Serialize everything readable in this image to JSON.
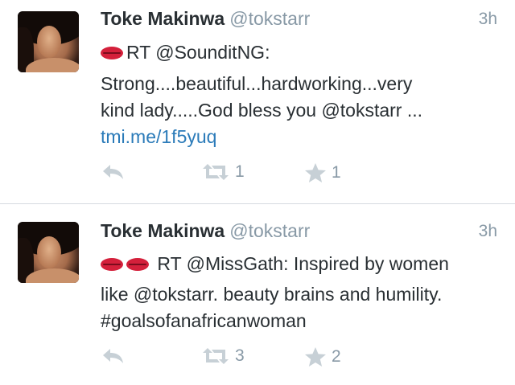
{
  "tweets": [
    {
      "name": "Toke Makinwa",
      "handle": "@tokstarr",
      "time": "3h",
      "lines": [
        "RT @SounditNG:",
        "Strong....beautiful...hardworking...very",
        "kind lady.....God bless you @tokstarr ..."
      ],
      "link": "tmi.me/1f5yuq",
      "retweets": "1",
      "favorites": "1"
    },
    {
      "name": "Toke Makinwa",
      "handle": "@tokstarr",
      "time": "3h",
      "lines": [
        "RT @MissGath: Inspired by women",
        "like @tokstarr. beauty brains and humility.",
        "#goalsofanafricanwoman"
      ],
      "retweets": "3",
      "favorites": "2"
    }
  ],
  "icons": {
    "reply": "reply-icon",
    "retweet": "retweet-icon",
    "favorite": "star-icon",
    "emoji": "kiss-mark-icon"
  },
  "colors": {
    "text": "#292f33",
    "muted": "#8899a6",
    "link": "#2b7bb9",
    "action_icon": "#c7d0d6"
  }
}
